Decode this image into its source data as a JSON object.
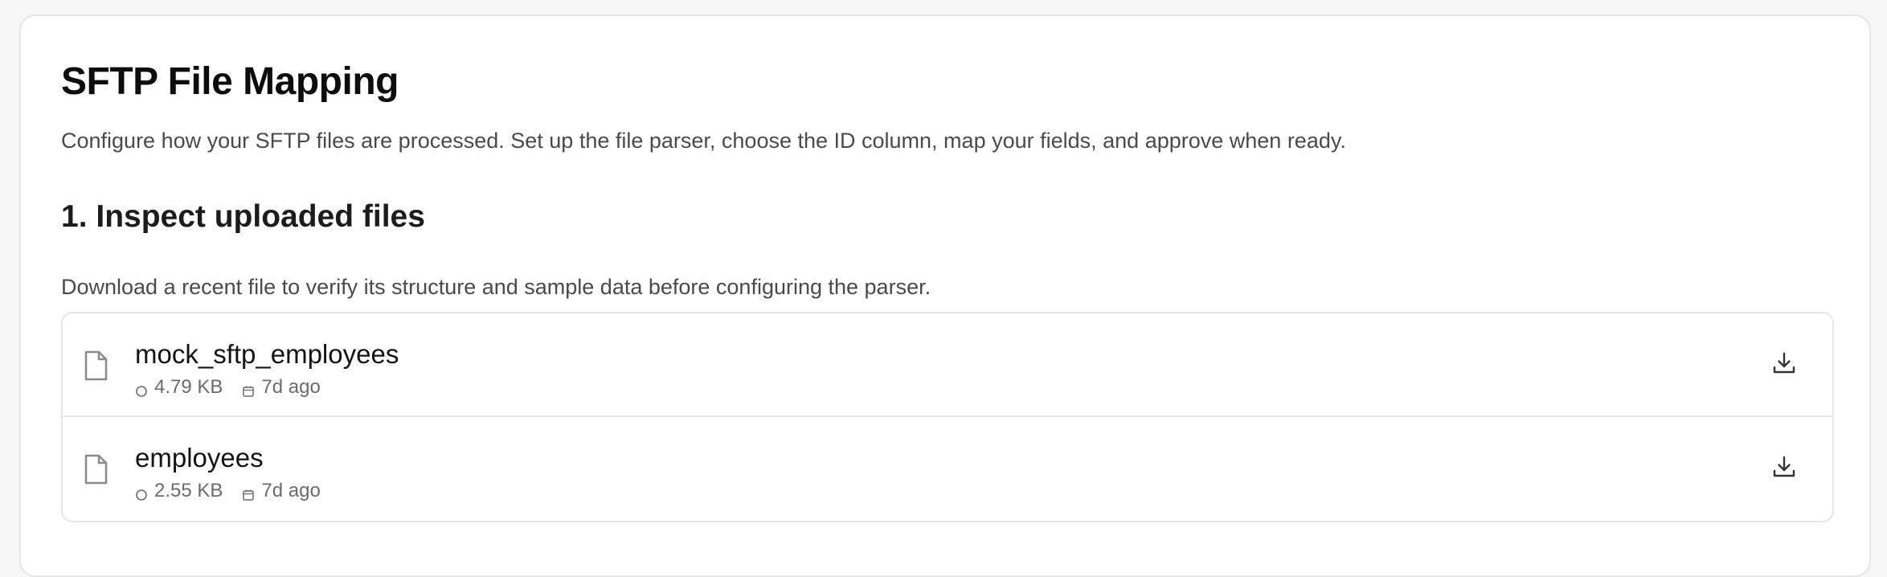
{
  "page": {
    "title": "SFTP File Mapping",
    "description": "Configure how your SFTP files are processed. Set up the file parser, choose the ID column, map your fields, and approve when ready."
  },
  "section1": {
    "title": "1. Inspect uploaded files",
    "description": "Download a recent file to verify its structure and sample data before configuring the parser."
  },
  "files": [
    {
      "name": "mock_sftp_employees",
      "size": "4.79 KB",
      "age": "7d ago",
      "icon": "file-icon",
      "action_icon": "download-icon"
    },
    {
      "name": "employees",
      "size": "2.55 KB",
      "age": "7d ago",
      "icon": "file-icon",
      "action_icon": "download-icon"
    }
  ],
  "colors": {
    "border": "#e6e6e6",
    "muted_text": "#6b6b6b",
    "body_text": "#4a4a4a"
  }
}
